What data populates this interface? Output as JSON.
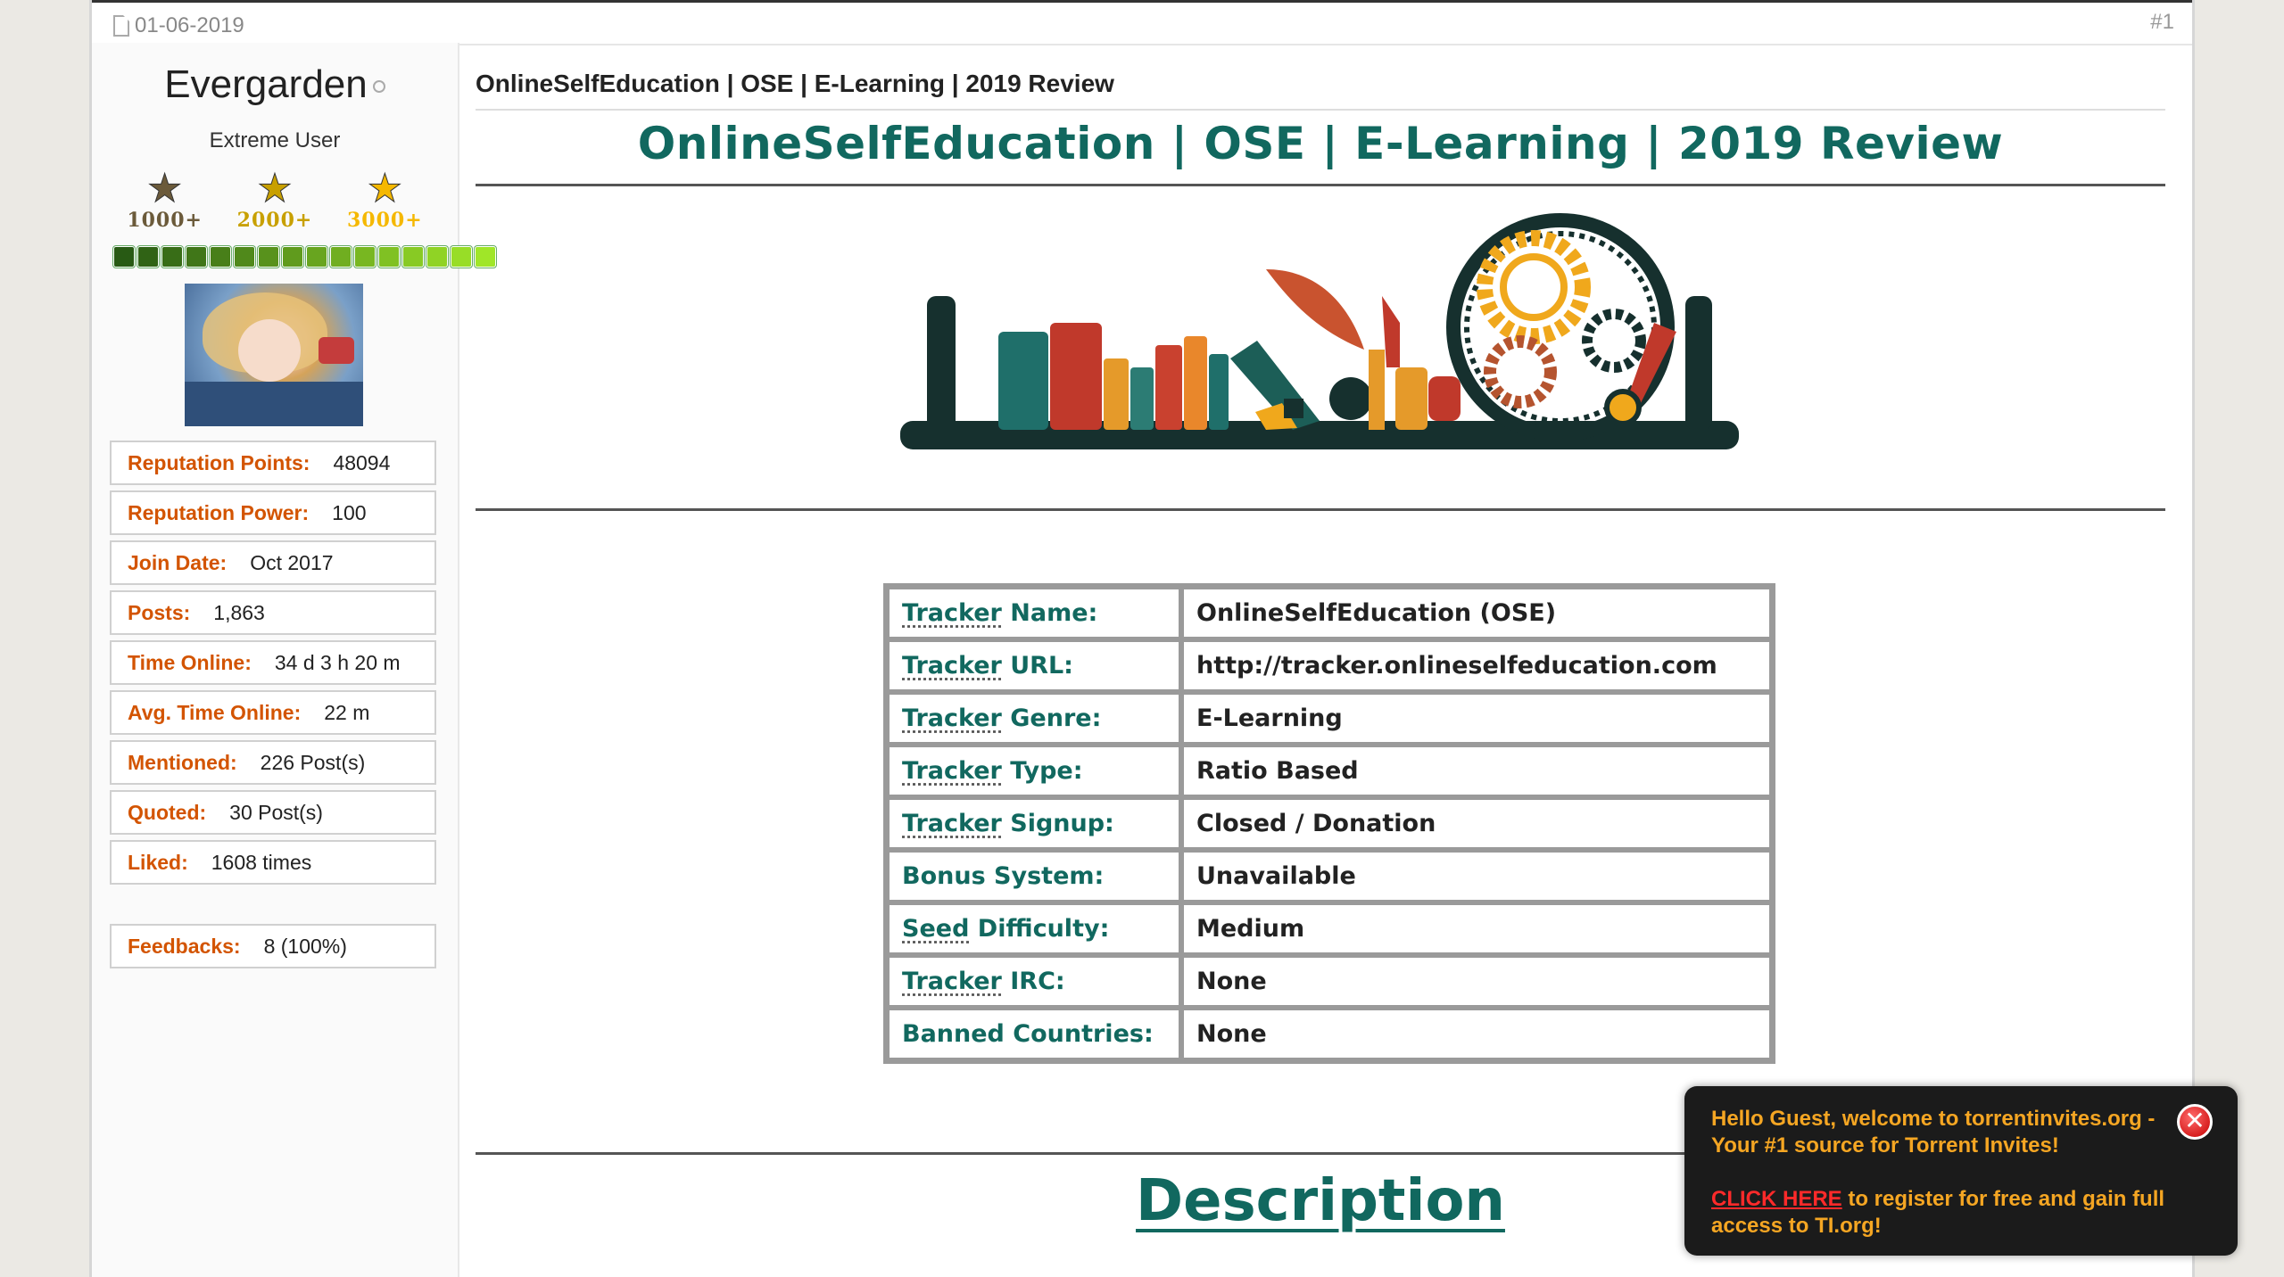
{
  "post": {
    "date": "01-06-2019",
    "number": "#1"
  },
  "user": {
    "name": "Evergarden",
    "title": "Extreme User",
    "stars": [
      {
        "label": "1000+",
        "color": "#6b5a3a"
      },
      {
        "label": "2000+",
        "color": "#c8a000"
      },
      {
        "label": "3000+",
        "color": "#f5b800"
      }
    ],
    "reputation_pips": 16,
    "info": [
      {
        "key": "Reputation Points:",
        "value": "48094"
      },
      {
        "key": "Reputation Power:",
        "value": "100"
      },
      {
        "key": "Join Date:",
        "value": "Oct 2017"
      },
      {
        "key": "Posts:",
        "value": "1,863"
      },
      {
        "key": "Time Online:",
        "value": "34 d 3 h 20 m"
      },
      {
        "key": "Avg. Time Online:",
        "value": "22 m"
      },
      {
        "key": "Mentioned:",
        "value": "226 Post(s)"
      },
      {
        "key": "Quoted:",
        "value": "30 Post(s)"
      },
      {
        "key": "Liked:",
        "value": "1608 times"
      }
    ],
    "feedbacks": {
      "key": "Feedbacks:",
      "value": "8 (100%)"
    }
  },
  "content": {
    "thread_title": "OnlineSelfEducation | OSE | E-Learning | 2019 Review",
    "heading": "OnlineSelfEducation | OSE | E-Learning | 2019 Review",
    "tracker_table": [
      {
        "label_parts": [
          "Tracker",
          " Name:"
        ],
        "value": "OnlineSelfEducation (OSE)"
      },
      {
        "label_parts": [
          "Tracker",
          " URL:"
        ],
        "value": "http://tracker.onlineselfeducation.com"
      },
      {
        "label_parts": [
          "Tracker",
          " Genre:"
        ],
        "value": "E-Learning"
      },
      {
        "label_parts": [
          "Tracker",
          " Type:"
        ],
        "value": "Ratio Based"
      },
      {
        "label_parts": [
          "Tracker",
          " Signup:"
        ],
        "value": "Closed / Donation"
      },
      {
        "label_parts": [
          "",
          "Bonus System:"
        ],
        "value": "Unavailable"
      },
      {
        "label_parts": [
          "Seed",
          " Difficulty:"
        ],
        "value": "Medium"
      },
      {
        "label_parts": [
          "Tracker",
          " IRC:"
        ],
        "value": "None"
      },
      {
        "label_parts": [
          "",
          "Banned Countries:"
        ],
        "value": "None"
      }
    ],
    "description_heading": "Description"
  },
  "popup": {
    "line1": "Hello Guest, welcome to torrentinvites.org - Your #1 source for Torrent Invites!",
    "cta": "CLICK HERE",
    "line2_rest": " to register for free and gain full access to TI.org!",
    "close_icon": "close-icon"
  },
  "colors": {
    "accent_teal": "#11685f",
    "label_orange": "#d35400",
    "popup_text": "#f5a623",
    "popup_cta": "#ff2a2a"
  }
}
